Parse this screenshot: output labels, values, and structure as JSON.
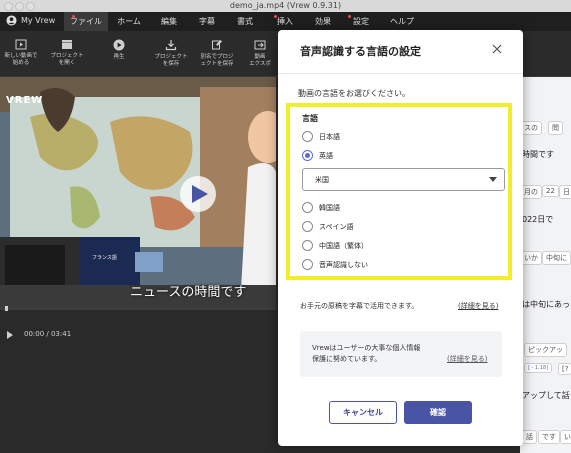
{
  "window": {
    "title": "demo_ja.mp4 (Vrew 0.9.31)"
  },
  "brand": {
    "label": "My Vrew"
  },
  "menu": [
    {
      "label": "ファイル",
      "active": true,
      "dot": true
    },
    {
      "label": "ホーム",
      "active": false,
      "dot": false
    },
    {
      "label": "編集",
      "active": false,
      "dot": false
    },
    {
      "label": "字幕",
      "active": false,
      "dot": false
    },
    {
      "label": "書式",
      "active": false,
      "dot": false
    },
    {
      "label": "挿入",
      "active": false,
      "dot": true
    },
    {
      "label": "効果",
      "active": false,
      "dot": false
    },
    {
      "label": "設定",
      "active": false,
      "dot": true
    },
    {
      "label": "ヘルプ",
      "active": false,
      "dot": false
    }
  ],
  "toolbar": {
    "new_video": "新しい動画で\n始める",
    "open_project": "プロジェクト\nを開く",
    "play": "再生",
    "save_project": "プロジェクト\nを保存",
    "save_as": "別名でプロジ\nェクトを保存",
    "export": "動画\nエクスポ"
  },
  "video": {
    "logo": "VREW",
    "subtitle": "ニュースの時間です",
    "sign": "フランス語"
  },
  "player": {
    "time": "00:00 / 03:41"
  },
  "right_panel": {
    "chip1": "スの",
    "chip2": "問",
    "text1": "時間です",
    "chip3": "月の",
    "chip4": "22",
    "chip5": "日",
    "text2": "022日で",
    "chip6": "いか",
    "chip7": "中旬に",
    "text3": "は中旬にあっ",
    "chip8": "ピックアッ",
    "chip9": "[ - 1.18]",
    "chip10": "[?",
    "text4": "アップして話",
    "chip11": "話",
    "chip12": "です",
    "chip13": "い"
  },
  "dialog": {
    "title": "音声認識する言語の設定",
    "prompt": "動画の言語をお選びください。",
    "language_label": "言語",
    "languages_top": [
      {
        "label": "日本語",
        "selected": false
      },
      {
        "label": "英語",
        "selected": true
      }
    ],
    "region_selected": "米国",
    "languages_bottom": [
      {
        "label": "韓国語",
        "selected": false
      },
      {
        "label": "スペイン語",
        "selected": false
      },
      {
        "label": "中国語（繁体）",
        "selected": false
      },
      {
        "label": "音声認識しない",
        "selected": false
      }
    ],
    "handwritten_note": "お手元の原稿を字幕で活用できます。",
    "handwritten_link": "(詳細を見る)",
    "privacy_text": "Vrewはユーザーの大事な個人情報\n保護に努めています。",
    "privacy_link": "(詳細を見る)",
    "cancel_label": "キャンセル",
    "confirm_label": "確認"
  },
  "colors": {
    "highlight": "#f2ef2a",
    "accent": "#4a54a4",
    "radio_selected": "#5c6ad6",
    "menubar": "#1f1f1f"
  }
}
